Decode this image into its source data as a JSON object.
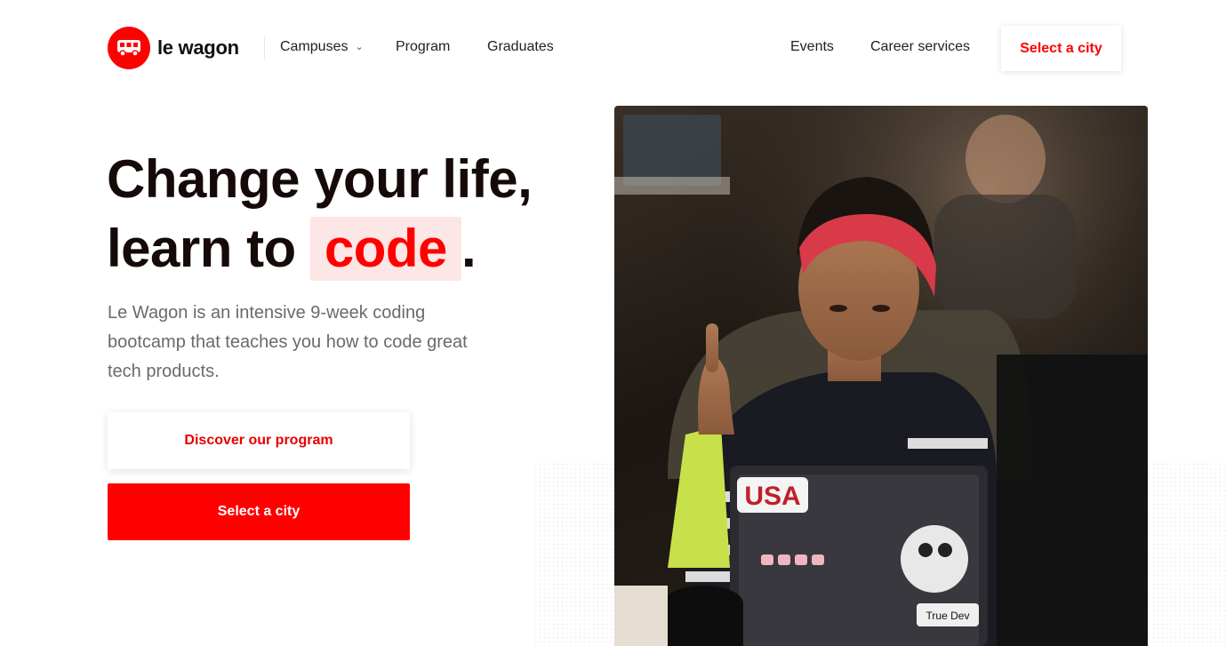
{
  "brand": {
    "name": "le wagon",
    "accent_color": "#ff0000",
    "logo_icon": "bus-icon"
  },
  "nav": {
    "left_links": [
      {
        "label": "Campuses",
        "icon": "chevron-down-icon"
      },
      {
        "label": "Program"
      },
      {
        "label": "Graduates"
      }
    ],
    "right_links": [
      {
        "label": "Events"
      },
      {
        "label": "Career services"
      }
    ],
    "cta_label": "Select a city"
  },
  "hero": {
    "title_line1": "Change your life,",
    "title_line2_prefix": "learn to",
    "title_highlight": "code",
    "title_suffix": ".",
    "description": "Le Wagon is an intensive 9-week coding bootcamp that teaches you how to code great tech products.",
    "primary_button_label": "Discover our program",
    "secondary_button_label": "Select a city"
  },
  "photo": {
    "laptop_sticker_text": "USA",
    "sticker_text_2": "True Dev"
  }
}
